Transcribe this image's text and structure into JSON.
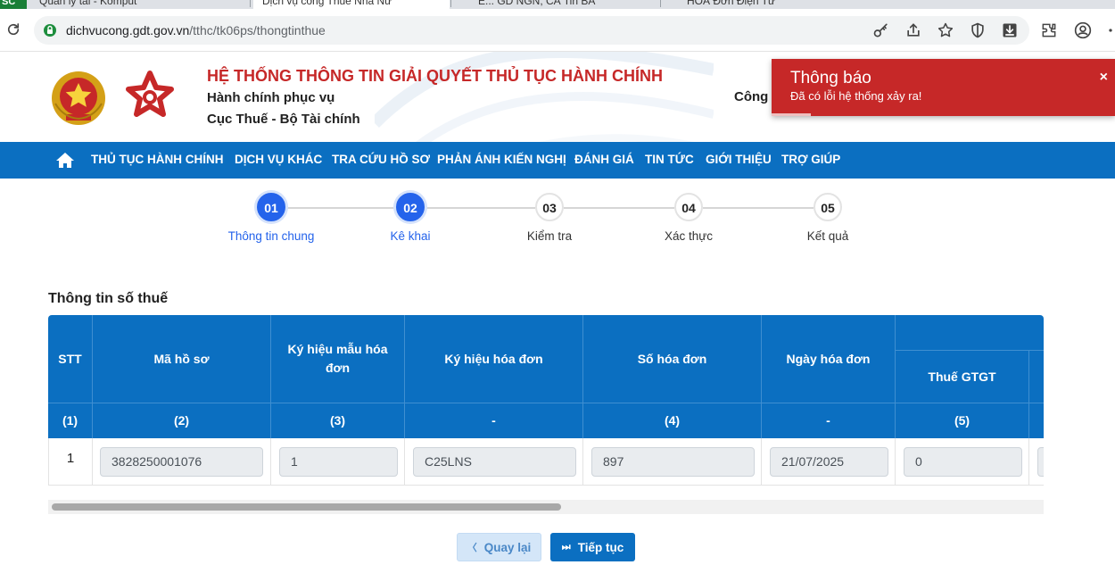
{
  "browser": {
    "tabs": [
      {
        "label": "Quản lý tài - Komput"
      },
      {
        "label": "Dịch vụ công Thuế Nhà Nư"
      },
      {
        "label": "Ế... GD NGN, CÁ Tin BÁ"
      },
      {
        "label": "HOÁ Đơn Điện Tử"
      }
    ],
    "badge": "SC",
    "url_host": "dichvucong.gdt.gov.vn",
    "url_path": "/tthc/tk06ps/thongtinthue"
  },
  "header": {
    "title": "HỆ THỐNG THÔNG TIN GIẢI QUYẾT THỦ TỤC HÀNH CHÍNH",
    "subtitle1": "Hành chính phục vụ",
    "subtitle2": "Cục Thuế - Bộ Tài chính",
    "right_text": "Công"
  },
  "toast": {
    "title": "Thông báo",
    "message": "Đã có lỗi hệ thống xảy ra!",
    "close": "×"
  },
  "nav": {
    "items": [
      "THỦ TỤC HÀNH CHÍNH",
      "DỊCH VỤ KHÁC",
      "TRA CỨU HỒ SƠ",
      "PHẢN ÁNH KIẾN NGHỊ",
      "ĐÁNH GIÁ",
      "TIN TỨC",
      "GIỚI THIỆU",
      "TRỢ GIÚP"
    ]
  },
  "stepper": {
    "steps": [
      {
        "num": "01",
        "label": "Thông tin chung",
        "state": "done"
      },
      {
        "num": "02",
        "label": "Kê khai",
        "state": "done"
      },
      {
        "num": "03",
        "label": "Kiểm tra",
        "state": "todo"
      },
      {
        "num": "04",
        "label": "Xác thực",
        "state": "todo"
      },
      {
        "num": "05",
        "label": "Kết quả",
        "state": "todo"
      }
    ]
  },
  "section": {
    "title": "Thông tin số thuế"
  },
  "table": {
    "headers": [
      "STT",
      "Mã hồ sơ",
      "Ký hiệu mẫu hóa đơn",
      "Ký hiệu hóa đơn",
      "Số hóa đơn",
      "Ngày hóa đơn",
      "Thuế GTGT"
    ],
    "codes": [
      "(1)",
      "(2)",
      "(3)",
      "-",
      "(4)",
      "-",
      "(5)"
    ],
    "rows": [
      {
        "stt": "1",
        "ma_ho_so": "3828250001076",
        "ky_hieu_mau": "1",
        "ky_hieu_hd": "C25LNS",
        "so_hd": "897",
        "ngay_hd": "21/07/2025",
        "thue_gtgt": "0"
      }
    ]
  },
  "buttons": {
    "back": "Quay lại",
    "next": "Tiếp tục"
  },
  "colors": {
    "primary": "#0b6fc1",
    "accent_red": "#c62828",
    "step_active": "#2463eb"
  }
}
